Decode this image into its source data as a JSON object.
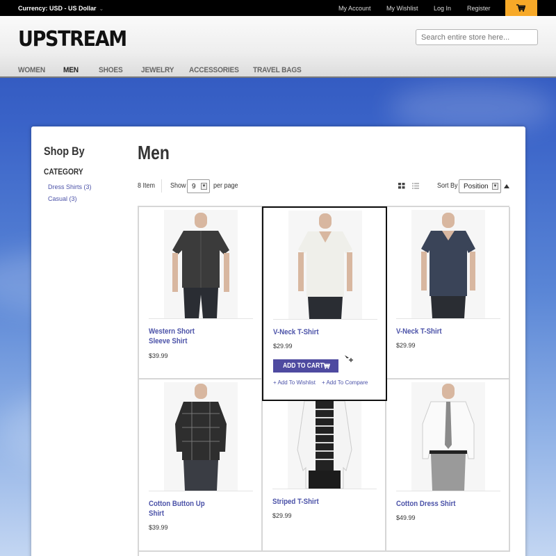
{
  "topbar": {
    "currency_label": "Currency: USD - US Dollar",
    "links": [
      "My Account",
      "My Wishlist",
      "Log In",
      "Register"
    ]
  },
  "header": {
    "logo": "UPSTREAM",
    "search_placeholder": "Search entire store here...",
    "nav": [
      "WOMEN",
      "MEN",
      "SHOES",
      "JEWELRY",
      "ACCESSORIES",
      "TRAVEL BAGS"
    ],
    "active_nav": "MEN"
  },
  "sidebar": {
    "title": "Shop By",
    "category_heading": "CATEGORY",
    "categories": [
      "Dress Shirts (3)",
      "Casual (3)"
    ]
  },
  "main": {
    "title": "Men",
    "item_count": "8 Item",
    "show_label": "Show",
    "per_page_value": "9",
    "per_page_label": "per page",
    "sort_label": "Sort By",
    "sort_value": "Position"
  },
  "products": [
    {
      "name": "Western Short Sleeve Shirt",
      "price": "$39.99"
    },
    {
      "name": "V-Neck T-Shirt",
      "price": "$29.99",
      "add_to_cart": "ADD TO CART",
      "wishlist": "Add To Wishlist",
      "compare": "Add To Compare"
    },
    {
      "name": "V-Neck T-Shirt",
      "price": "$29.99"
    },
    {
      "name": "Cotton Button Up Shirt",
      "price": "$39.99"
    },
    {
      "name": "Striped T-Shirt",
      "price": "$29.99"
    },
    {
      "name": "Cotton Dress Shirt",
      "price": "$49.99"
    }
  ],
  "colors": {
    "accent": "#4e4aa0",
    "cart_button": "#f7a928",
    "link": "#4b52a8"
  }
}
